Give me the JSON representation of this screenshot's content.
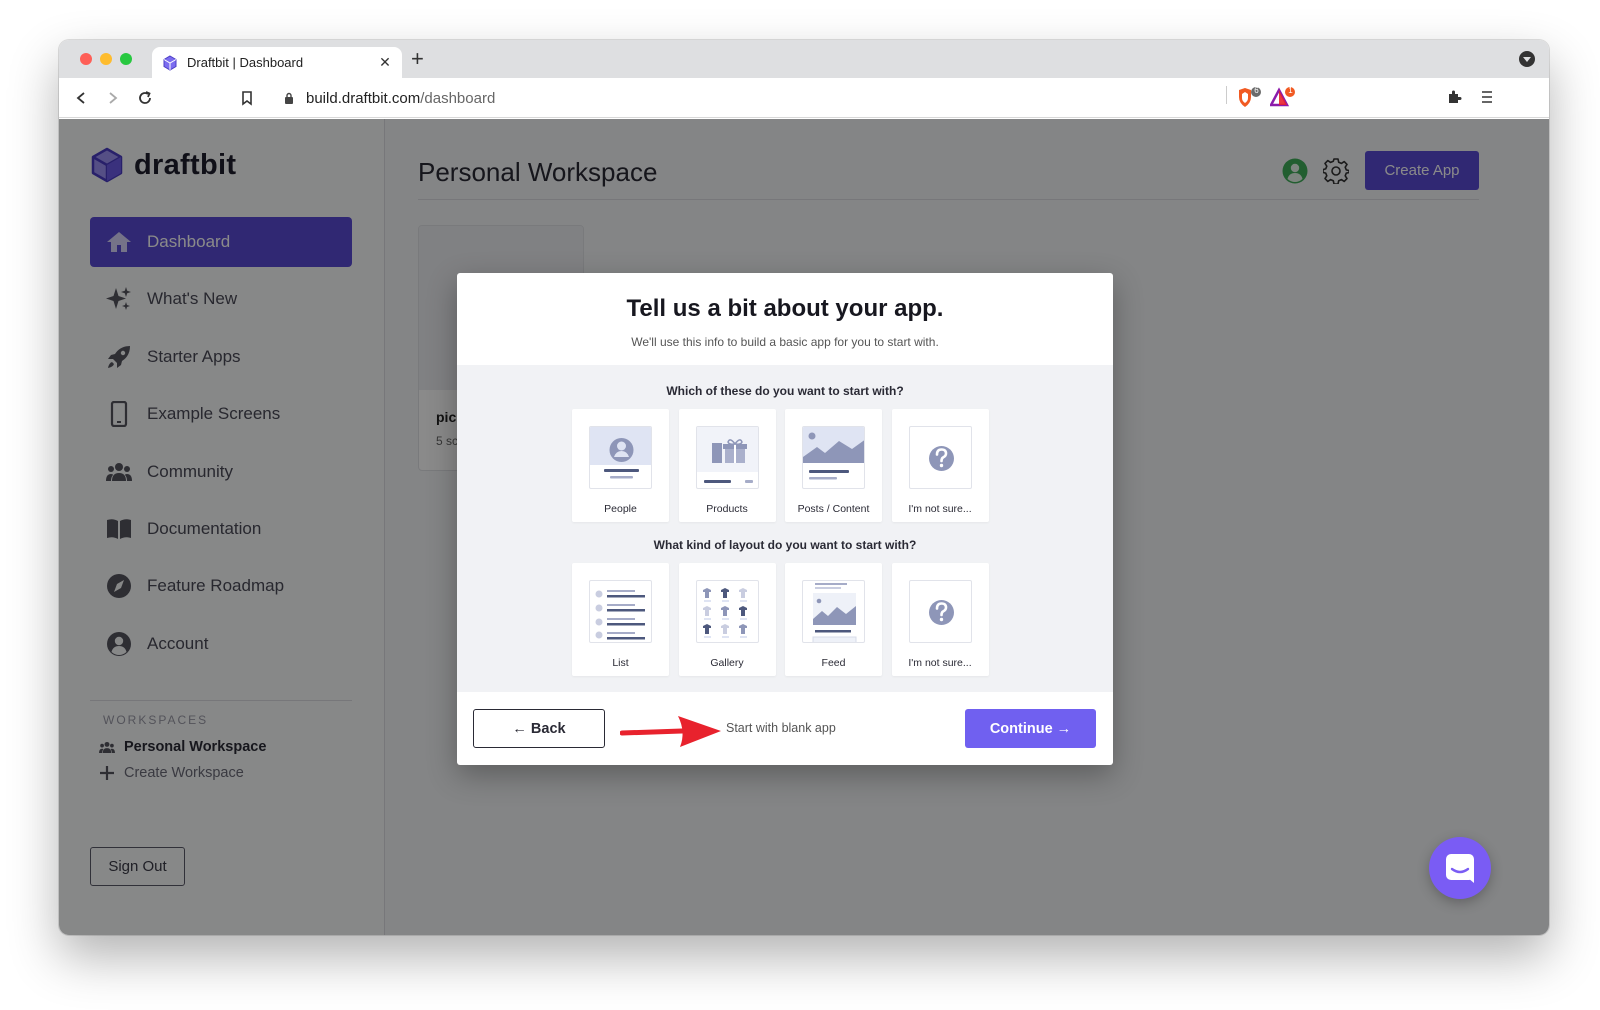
{
  "browser": {
    "tab_title": "Draftbit | Dashboard",
    "url_host": "build.draftbit.com",
    "url_path": "/dashboard",
    "brave_shield_count": "6",
    "rewards_count": "1"
  },
  "sidebar": {
    "logo_text": "draftbit",
    "items": [
      {
        "label": "Dashboard",
        "icon": "home-icon",
        "active": true
      },
      {
        "label": "What's New",
        "icon": "sparkles-icon"
      },
      {
        "label": "Starter Apps",
        "icon": "rocket-icon"
      },
      {
        "label": "Example Screens",
        "icon": "phone-icon"
      },
      {
        "label": "Community",
        "icon": "users-icon"
      },
      {
        "label": "Documentation",
        "icon": "book-icon"
      },
      {
        "label": "Feature Roadmap",
        "icon": "compass-icon"
      },
      {
        "label": "Account",
        "icon": "user-circle-icon"
      }
    ],
    "workspaces_heading": "WORKSPACES",
    "personal_workspace": "Personal Workspace",
    "create_workspace": "Create Workspace",
    "sign_out": "Sign Out"
  },
  "main": {
    "title": "Personal Workspace",
    "create_app": "Create App",
    "app_card": {
      "name": "pic",
      "meta": "5 sc"
    }
  },
  "modal": {
    "title": "Tell us a bit about your app.",
    "subtitle": "We'll use this info to build a basic app for you to start with.",
    "question_1": "Which of these do you want to start with?",
    "options_1": [
      "People",
      "Products",
      "Posts / Content",
      "I'm not sure..."
    ],
    "question_2": "What kind of layout do you want to start with?",
    "options_2": [
      "List",
      "Gallery",
      "Feed",
      "I'm not sure..."
    ],
    "back": "← Back",
    "blank_app": "Start with blank app",
    "continue": "Continue →"
  },
  "colors": {
    "brand": "#5a4bd4",
    "continue": "#7060f0",
    "arrow": "#e8222d",
    "messenger": "#7a5cf4"
  }
}
